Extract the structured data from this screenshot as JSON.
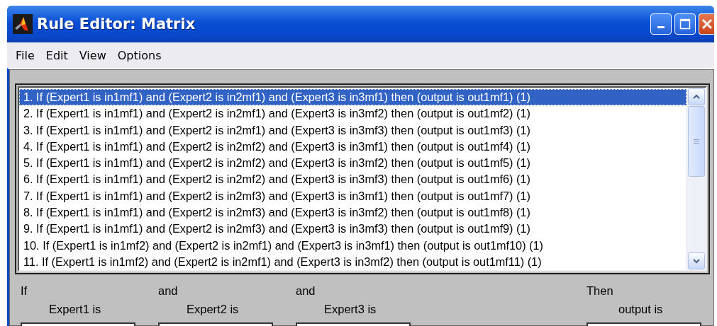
{
  "window": {
    "title": "Rule Editor: Matrix"
  },
  "menu": [
    "File",
    "Edit",
    "View",
    "Options"
  ],
  "rules": [
    {
      "text": "1. If (Expert1 is in1mf1) and (Expert2 is in2mf1) and (Expert3 is in3mf1) then (output is out1mf1) (1)",
      "selected": true
    },
    {
      "text": "2. If (Expert1 is in1mf1) and (Expert2 is in2mf1) and (Expert3 is in3mf2) then (output is out1mf2) (1)",
      "selected": false
    },
    {
      "text": "3. If (Expert1 is in1mf1) and (Expert2 is in2mf1) and (Expert3 is in3mf3) then (output is out1mf3) (1)",
      "selected": false
    },
    {
      "text": "4. If (Expert1 is in1mf1) and (Expert2 is in2mf2) and (Expert3 is in3mf1) then (output is out1mf4) (1)",
      "selected": false
    },
    {
      "text": "5. If (Expert1 is in1mf1) and (Expert2 is in2mf2) and (Expert3 is in3mf2) then (output is out1mf5) (1)",
      "selected": false
    },
    {
      "text": "6. If (Expert1 is in1mf1) and (Expert2 is in2mf2) and (Expert3 is in3mf3) then (output is out1mf6) (1)",
      "selected": false
    },
    {
      "text": "7. If (Expert1 is in1mf1) and (Expert2 is in2mf3) and (Expert3 is in3mf1) then (output is out1mf7) (1)",
      "selected": false
    },
    {
      "text": "8. If (Expert1 is in1mf1) and (Expert2 is in2mf3) and (Expert3 is in3mf2) then (output is out1mf8) (1)",
      "selected": false
    },
    {
      "text": "9. If (Expert1 is in1mf1) and (Expert2 is in2mf3) and (Expert3 is in3mf3) then (output is out1mf9) (1)",
      "selected": false
    },
    {
      "text": "10. If (Expert1 is in1mf2) and (Expert2 is in2mf1) and (Expert3 is in3mf1) then (output is out1mf10) (1)",
      "selected": false
    },
    {
      "text": "11. If (Expert1 is in1mf2) and (Expert2 is in2mf1) and (Expert3 is in3mf2) then (output is out1mf11) (1)",
      "selected": false
    }
  ],
  "inputs": [
    {
      "connector": "If",
      "label": "Expert1 is"
    },
    {
      "connector": "and",
      "label": "Expert2 is"
    },
    {
      "connector": "and",
      "label": "Expert3 is"
    }
  ],
  "output": {
    "connector": "Then",
    "label": "output is"
  }
}
